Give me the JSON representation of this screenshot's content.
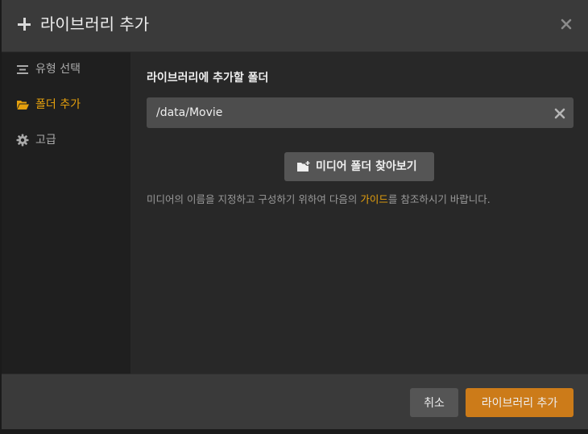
{
  "dialog": {
    "title": "라이브러리 추가",
    "icons": {
      "header": "plus-icon",
      "close": "close-icon"
    }
  },
  "sidebar": {
    "items": [
      {
        "label": "유형 선택",
        "icon": "list-icon",
        "active": false
      },
      {
        "label": "폴더 추가",
        "icon": "folder-open-icon",
        "active": true
      },
      {
        "label": "고급",
        "icon": "gear-icon",
        "active": false
      }
    ]
  },
  "content": {
    "section_label": "라이브러리에 추가할 폴더",
    "path_input": {
      "value": "/data/Movie"
    },
    "browse_button": {
      "label": "미디어 폴더 찾아보기",
      "icon": "folder-add-icon"
    },
    "help": {
      "before": "미디어의 이름을 지정하고 구성하기 위하여 다음의 ",
      "link": "가이드",
      "after": "를 참조하시기 바랍니다."
    }
  },
  "footer": {
    "cancel_label": "취소",
    "add_label": "라이브러리 추가"
  },
  "colors": {
    "accent": "#e5a00d",
    "primary_button": "#cc7b19",
    "header_bg": "#3a3a3a",
    "sidebar_bg": "#1f1f1f",
    "content_bg": "#282828"
  }
}
